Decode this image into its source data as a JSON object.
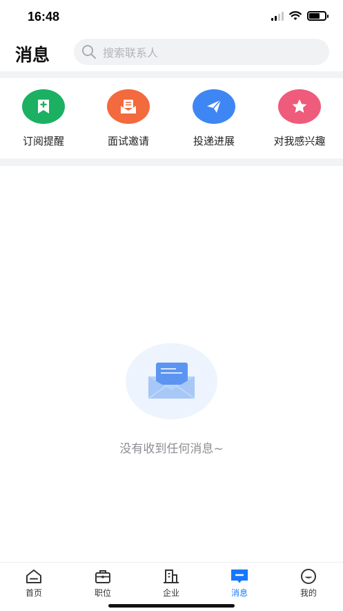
{
  "status_bar": {
    "time": "16:48"
  },
  "header": {
    "title": "消息",
    "search_placeholder": "搜索联系人"
  },
  "shortcuts": [
    {
      "label": "订阅提醒",
      "icon": "bookmark-plus-icon",
      "color": "#1bb062"
    },
    {
      "label": "面试邀请",
      "icon": "envelope-open-icon",
      "color": "#f26a3d"
    },
    {
      "label": "投递进展",
      "icon": "paper-plane-icon",
      "color": "#3f86f5"
    },
    {
      "label": "对我感兴趣",
      "icon": "star-icon",
      "color": "#ef5b7a"
    }
  ],
  "empty_state": {
    "message": "没有收到任何消息~",
    "icon": "mail-envelope-icon"
  },
  "tabbar": {
    "active": "消息",
    "active_color": "#1677ff",
    "items": [
      {
        "label": "首页",
        "icon": "home-icon"
      },
      {
        "label": "职位",
        "icon": "briefcase-icon"
      },
      {
        "label": "企业",
        "icon": "building-icon"
      },
      {
        "label": "消息",
        "icon": "message-icon"
      },
      {
        "label": "我的",
        "icon": "profile-icon"
      }
    ]
  }
}
